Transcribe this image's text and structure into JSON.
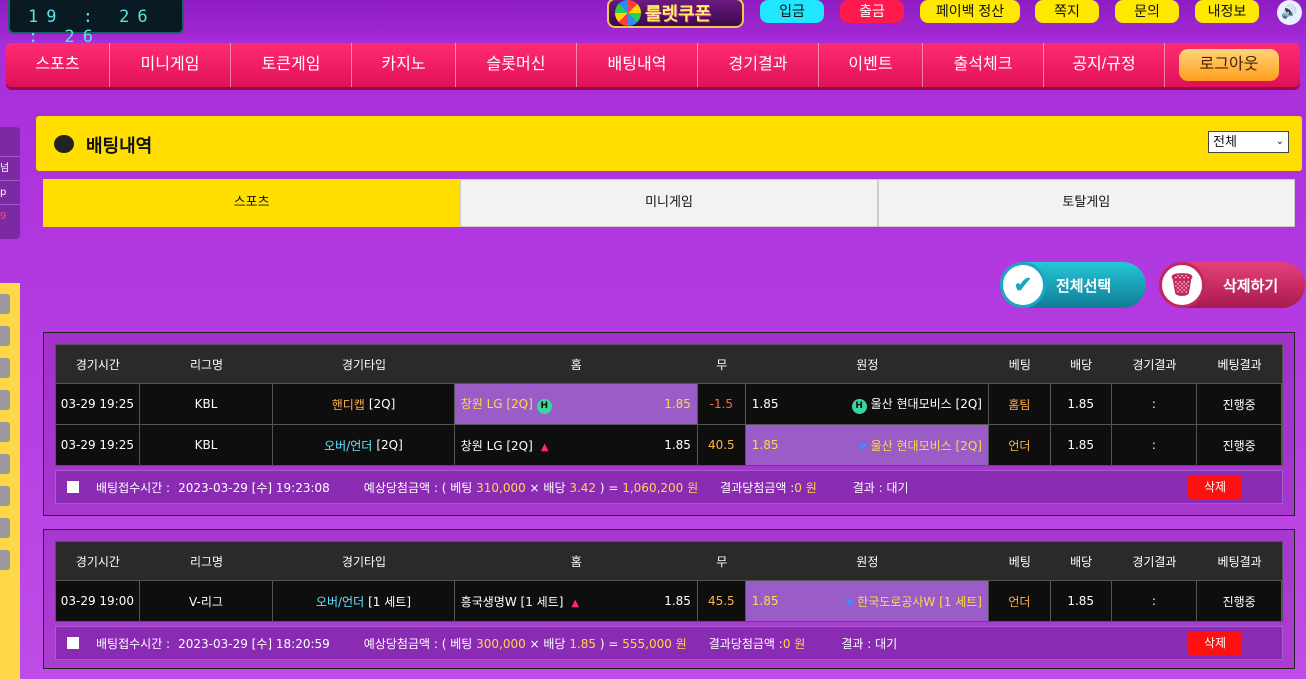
{
  "clock": "19 : 26 : 26",
  "logo": "룰렛쿠폰",
  "top_buttons": [
    {
      "label": "입금",
      "color": "#20e6ff"
    },
    {
      "label": "출금",
      "color": "#ff1a4d"
    },
    {
      "label": "페이백 정산",
      "color": "#ffe800"
    },
    {
      "label": "쪽지",
      "color": "#ffe800"
    },
    {
      "label": "문의",
      "color": "#ffe800"
    },
    {
      "label": "내정보",
      "color": "#ffe800"
    }
  ],
  "nav": [
    "스포츠",
    "미니게임",
    "토큰게임",
    "카지노",
    "슬롯머신",
    "배팅내역",
    "경기결과",
    "이벤트",
    "출석체크",
    "공지/규정"
  ],
  "logout": "로그아웃",
  "sidebar_snippets": [
    "넘",
    "p",
    "9"
  ],
  "page_title": "배팅내역",
  "filter": "전체",
  "tabs": [
    "스포츠",
    "미니게임",
    "토탈게임"
  ],
  "select_all": "전체선택",
  "delete_all": "삭제하기",
  "headers": [
    "경기시간",
    "리그명",
    "경기타입",
    "홈",
    "무",
    "원정",
    "베팅",
    "배당",
    "경기결과",
    "베팅결과"
  ],
  "bets": [
    {
      "rows": [
        {
          "time": "03-29 19:25",
          "league": "KBL",
          "type_main": "핸디캡",
          "type_color": "#ffb347",
          "type_sub": "[2Q]",
          "home": "창원 LG [2Q]",
          "home_odds": "1.85",
          "home_hl": true,
          "home_badge": "H",
          "home_arrow": "",
          "draw": "-1.5",
          "draw_color": "#ff6a3d",
          "away": "울산 현대모비스 [2Q]",
          "away_odds": "1.85",
          "away_hl": false,
          "away_badge": "H",
          "away_arrow": "",
          "pick": "홈팀",
          "pick_color": "#ffb347",
          "odds": "1.85",
          "result": ":",
          "status": "진행중"
        },
        {
          "time": "03-29 19:25",
          "league": "KBL",
          "type_main": "오버/언더",
          "type_color": "#66e3ff",
          "type_sub": "[2Q]",
          "home": "창원 LG [2Q]",
          "home_odds": "1.85",
          "home_hl": false,
          "home_badge": "",
          "home_arrow": "▲",
          "draw": "40.5",
          "draw_color": "#ffb347",
          "away": "울산 현대모비스 [2Q]",
          "away_odds": "1.85",
          "away_hl": true,
          "away_badge": "",
          "away_arrow": "▼",
          "pick": "언더",
          "pick_color": "#ffb347",
          "odds": "1.85",
          "result": ":",
          "status": "진행중"
        }
      ],
      "footer": {
        "time_label": "배팅접수시간 :",
        "time": "2023-03-29 [수] 19:23:08",
        "expect_pre": "예상당첨금액 : ( 베팅 ",
        "stake": "310,000",
        "mult": " × 배당 ",
        "odds": "3.42",
        "eq": " ) = ",
        "payout": "1,060,200 원",
        "won_label": "결과당첨금액 : ",
        "won": "0 원",
        "result": "결과 : 대기",
        "delete": "삭제"
      }
    },
    {
      "rows": [
        {
          "time": "03-29 19:00",
          "league": "V-리그",
          "type_main": "오버/언더",
          "type_color": "#66e3ff",
          "type_sub": "[1 세트]",
          "home": "흥국생명W [1 세트]",
          "home_odds": "1.85",
          "home_hl": false,
          "home_badge": "",
          "home_arrow": "▲",
          "draw": "45.5",
          "draw_color": "#ffb347",
          "away": "한국도로공사W [1 세트]",
          "away_odds": "1.85",
          "away_hl": true,
          "away_badge": "",
          "away_arrow": "▼",
          "pick": "언더",
          "pick_color": "#ffb347",
          "odds": "1.85",
          "result": ":",
          "status": "진행중"
        }
      ],
      "footer": {
        "time_label": "배팅접수시간 :",
        "time": "2023-03-29 [수] 18:20:59",
        "expect_pre": "예상당첨금액 : ( 베팅 ",
        "stake": "300,000",
        "mult": " × 배당 ",
        "odds": "1.85",
        "eq": " ) = ",
        "payout": "555,000 원",
        "won_label": "결과당첨금액 : ",
        "won": "0 원",
        "result": "결과 : 대기",
        "delete": "삭제"
      }
    }
  ]
}
